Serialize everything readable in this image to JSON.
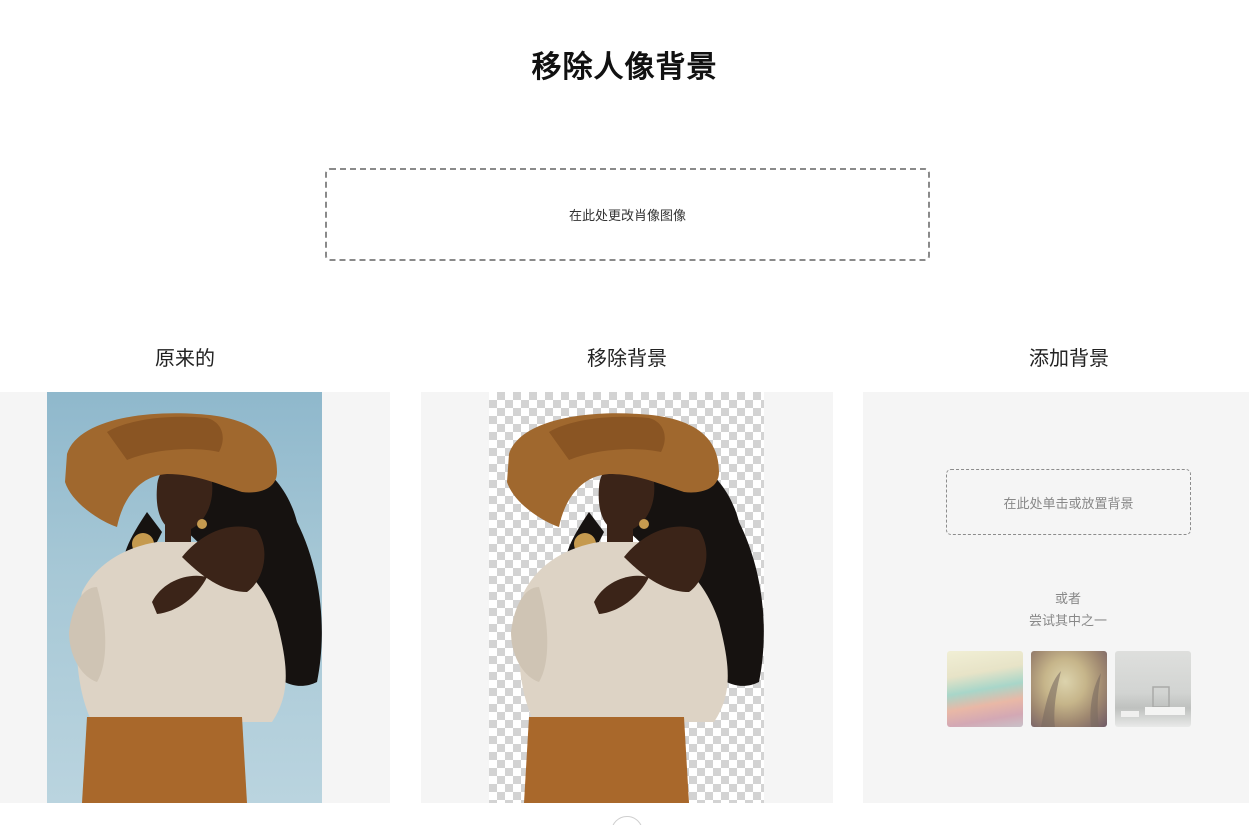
{
  "page": {
    "title": "移除人像背景",
    "upload_label": "在此处更改肖像图像"
  },
  "columns": {
    "original": {
      "heading": "原来的"
    },
    "removed": {
      "heading": "移除背景"
    },
    "add": {
      "heading": "添加背景",
      "drop_label": "在此处单击或放置背景",
      "or_label": "或者",
      "try_label": "尝试其中之一"
    }
  },
  "backgrounds": [
    {
      "name": "pastel-watercolor"
    },
    {
      "name": "misty-forest"
    },
    {
      "name": "white-room"
    }
  ],
  "colors": {
    "panel_bg": "#f5f5f5",
    "sky": "#a7c8d6",
    "hat": "#a0682e",
    "shirt": "#ddd3c5",
    "skirt": "#a9682b",
    "hair": "#161210",
    "skin": "#3b2418"
  }
}
